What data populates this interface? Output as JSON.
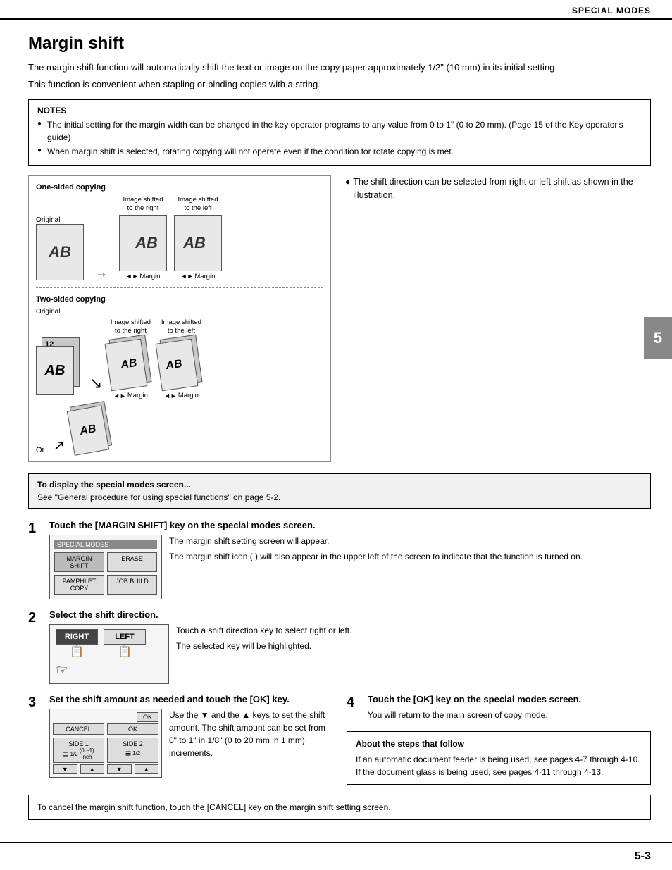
{
  "header": {
    "title": "SPECIAL MODES"
  },
  "page_title": "Margin shift",
  "intro": [
    "The margin shift function will automatically shift the text or image on the copy paper approximately 1/2\" (10 mm) in its initial setting.",
    "This function is convenient when stapling or binding copies with a string."
  ],
  "notes": {
    "title": "NOTES",
    "items": [
      "The initial setting for the margin width can be changed in the key operator programs to any value from 0 to 1\" (0 to 20 mm). (Page 15 of the Key operator's guide)",
      "When margin shift is selected, rotating copying will not operate even if the condition for rotate copying is met."
    ]
  },
  "diagram": {
    "one_sided_title": "One-sided copying",
    "two_sided_title": "Two-sided copying",
    "original_label": "Original",
    "image_shifted_right": "Image shifted\nto the right",
    "image_shifted_left": "Image shifted\nto the left",
    "margin_label": "Margin",
    "or_label": "Or",
    "ab_text": "AB"
  },
  "right_col_note": "●The shift direction can be selected from right or left shift as shown in the illustration.",
  "to_display_box": {
    "title": "To display the special modes screen...",
    "text": "See \"General procedure for using special functions\" on page 5-2."
  },
  "steps": [
    {
      "number": "1",
      "title": "Touch the [MARGIN SHIFT] key on the special modes screen.",
      "text_lines": [
        "The margin shift setting screen will appear.",
        "The margin shift icon ( ) will also appear in the upper left of the screen to indicate that the function is turned on."
      ],
      "screen": {
        "header": "SPECIAL MODES",
        "btn1": "MARGIN SHIFT",
        "btn2": "ERASE",
        "btn3": "PAMPHLET COPY",
        "btn4": "JOB BUILD"
      }
    },
    {
      "number": "2",
      "title": "Select the shift direction.",
      "text_lines": [
        "Touch a shift direction key to select right or left.",
        "The selected key will be highlighted."
      ],
      "dir_buttons": {
        "right_label": "RIGHT",
        "left_label": "LEFT"
      }
    },
    {
      "number": "3",
      "title": "Set the shift amount as needed and touch the [OK] key.",
      "text_lines": [
        "Use the ▼ and the ▲ keys to set the shift amount. The shift amount can be set from 0\" to 1\" in 1/8\" (0 to 20 mm in 1 mm) increments."
      ],
      "screen": {
        "ok_label": "OK",
        "cancel_label": "CANCEL",
        "side1_label": "SIDE 1",
        "side2_label": "SIDE 2",
        "value": "1/2",
        "unit": "inch"
      }
    },
    {
      "number": "4",
      "title": "Touch the [OK] key on the special modes screen.",
      "text_lines": [
        "You will return to the main screen of copy mode."
      ]
    }
  ],
  "about_steps": {
    "title": "About the steps that follow",
    "text": "If an automatic document feeder is being used, see pages 4-7 through 4-10. If the document glass is being used, see pages 4-11 through 4-13."
  },
  "cancel_note": "To cancel the margin shift function, touch the [CANCEL] key on the margin shift setting screen.",
  "chapter_number": "5",
  "page_number": "5-3"
}
